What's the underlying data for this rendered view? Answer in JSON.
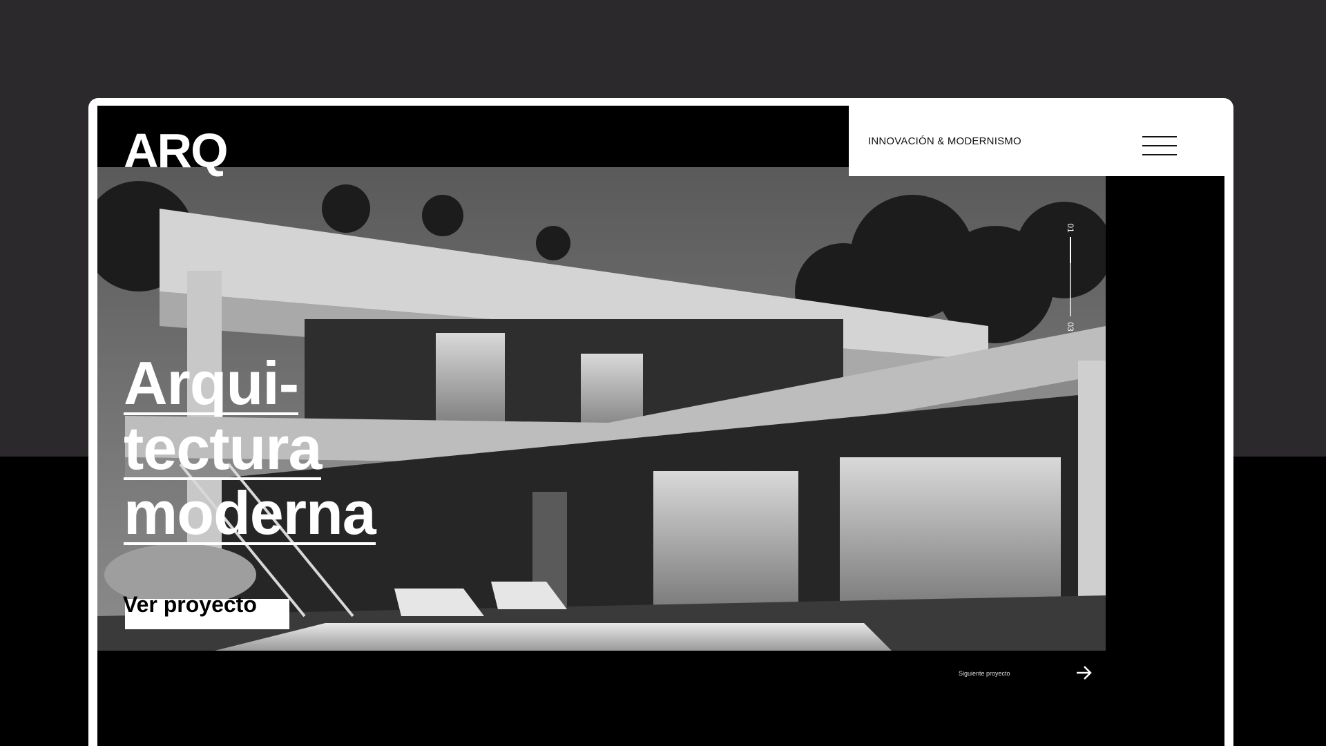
{
  "app": {
    "logo": "ARQ",
    "tagline": "INNOVACIÓN & MODERNISMO",
    "menu_icon": "hamburger-menu-icon"
  },
  "hero": {
    "image_description_icon": "house-photo",
    "title_lines": [
      "Arqui-",
      "tectura",
      "moderna"
    ],
    "cta_label": "Ver proyecto",
    "slide_indicator": {
      "current": "01",
      "total": "03",
      "progress": 0.33
    },
    "next_label": "Siguiente proyecto",
    "next_icon": "arrow-right-icon"
  },
  "colors": {
    "background": "#2b292b",
    "frame": "#ffffff",
    "screen": "#000000",
    "accent": "#ffffff"
  }
}
